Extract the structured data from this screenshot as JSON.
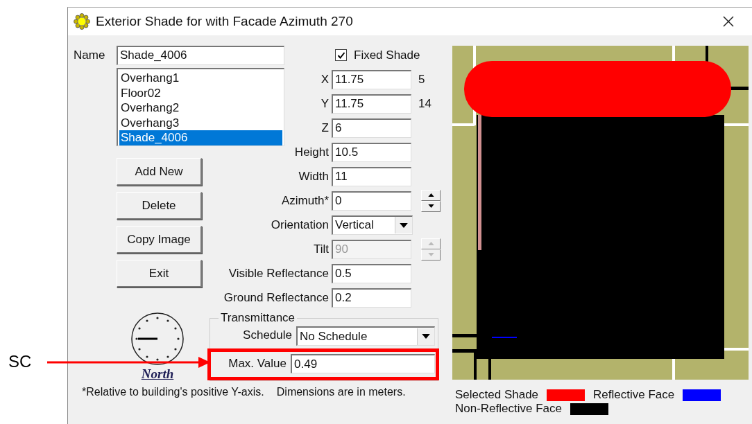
{
  "annotation": {
    "label": "SC",
    "highlighted": true
  },
  "window": {
    "title": "Exterior Shade for with Facade Azimuth 270"
  },
  "name_field": {
    "label": "Name",
    "value": "Shade_4006"
  },
  "shade_list": [
    {
      "label": "Overhang1",
      "selected": false
    },
    {
      "label": "Floor02",
      "selected": false
    },
    {
      "label": "Overhang2",
      "selected": false
    },
    {
      "label": "Overhang3",
      "selected": false
    },
    {
      "label": "Shade_4006",
      "selected": true
    }
  ],
  "fixed_shade": {
    "label": "Fixed Shade",
    "checked": true
  },
  "fields": [
    {
      "kind": "text",
      "label": "X",
      "value": "11.75",
      "note": "5",
      "disabled": false
    },
    {
      "kind": "text",
      "label": "Y",
      "value": "11.75",
      "note": "14",
      "disabled": false
    },
    {
      "kind": "text",
      "label": "Z",
      "value": "6",
      "disabled": false
    },
    {
      "kind": "text",
      "label": "Height",
      "value": "10.5",
      "disabled": false
    },
    {
      "kind": "text",
      "label": "Width",
      "value": "11",
      "disabled": false
    },
    {
      "kind": "spin",
      "label": "Azimuth*",
      "value": "0",
      "disabled": false
    },
    {
      "kind": "dropdown",
      "label": "Orientation",
      "value": "Vertical",
      "disabled": false
    },
    {
      "kind": "spin",
      "label": "Tilt",
      "value": "90",
      "disabled": true
    },
    {
      "kind": "text",
      "label": "Visible Reflectance",
      "value": "0.5",
      "disabled": false
    },
    {
      "kind": "text",
      "label": "Ground Reflectance",
      "value": "0.2",
      "disabled": false
    }
  ],
  "buttons": [
    "Add New",
    "Delete",
    "Copy Image",
    "Exit"
  ],
  "compass": {
    "label": "North"
  },
  "transmittance": {
    "title": "Transmittance",
    "schedule_label": "Schedule",
    "schedule_value": "No Schedule",
    "max_label": "Max. Value",
    "max_value": "0.49"
  },
  "footnotes": [
    "*Relative to building's positive Y-axis.",
    "Dimensions are in meters."
  ],
  "legend": [
    {
      "label": "Selected Shade",
      "color": "#ff0000"
    },
    {
      "label": "Reflective Face",
      "color": "#0000ff"
    },
    {
      "label": "Non-Reflective Face",
      "color": "#000000"
    }
  ]
}
